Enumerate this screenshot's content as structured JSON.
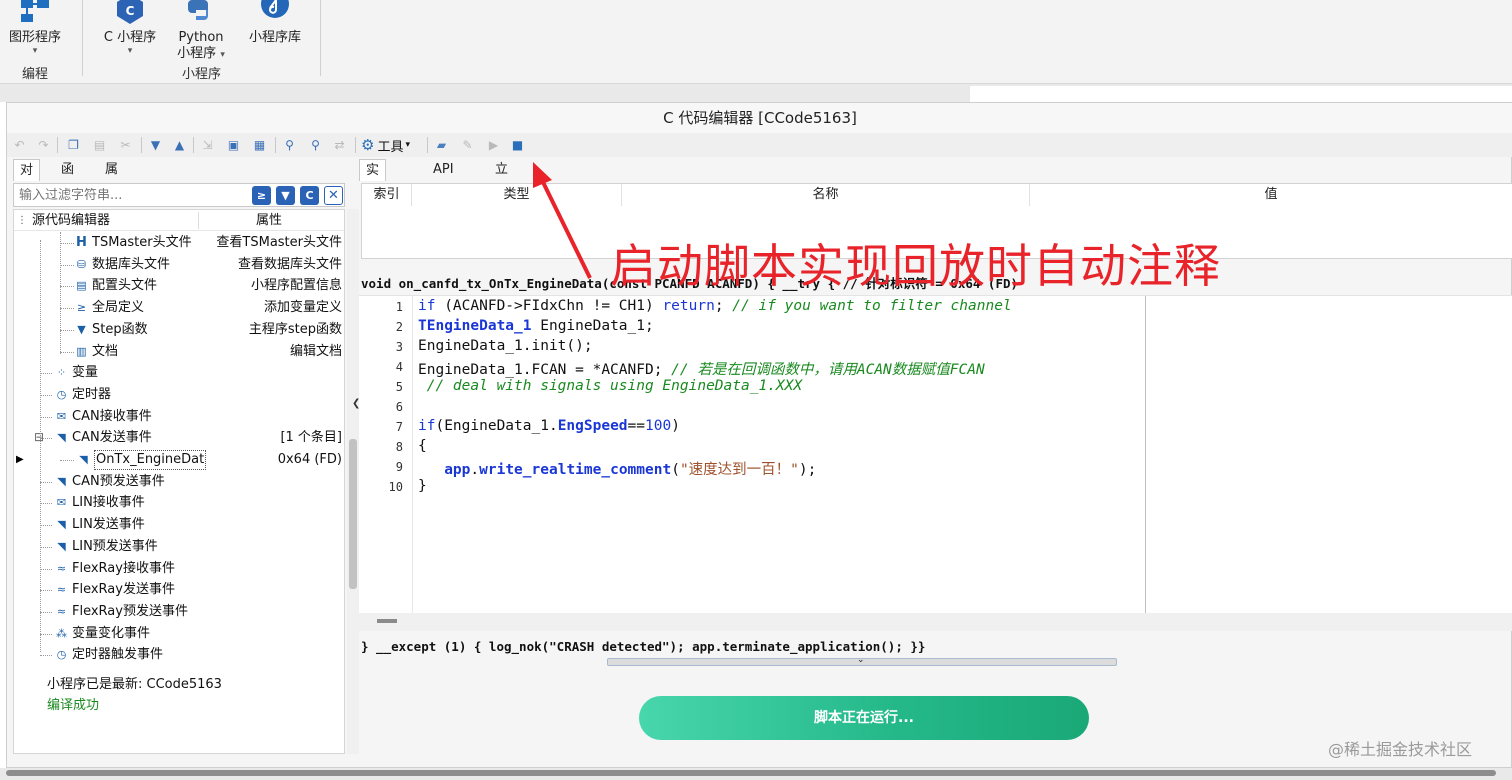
{
  "ribbon": {
    "graphic_program": "图形程序",
    "group_edit": "编程",
    "c_program": "C 小程序",
    "python_line1": "Python",
    "python_line2": "小程序",
    "library": "小程序库",
    "group_program": "小程序"
  },
  "window": {
    "title": "C 代码编辑器 [CCode5163]"
  },
  "toolbar": {
    "tools_label": "工具"
  },
  "left_tabs": [
    "对象",
    "函数",
    "属性"
  ],
  "filter": {
    "placeholder": "输入过滤字符串..."
  },
  "tree": {
    "header_name": "源代码编辑器",
    "header_prop": "属性",
    "rows": [
      {
        "name": "TSMaster头文件",
        "prop": "查看TSMaster头文件",
        "icon": "h-header-icon"
      },
      {
        "name": "数据库头文件",
        "prop": "查看数据库头文件",
        "icon": "database-icon"
      },
      {
        "name": "配置头文件",
        "prop": "小程序配置信息",
        "icon": "config-file-icon"
      },
      {
        "name": "全局定义",
        "prop": "添加变量定义",
        "icon": "global-define-icon"
      },
      {
        "name": "Step函数",
        "prop": "主程序step函数",
        "icon": "step-triangle-icon"
      },
      {
        "name": "文档",
        "prop": "编辑文档",
        "icon": "book-icon"
      },
      {
        "name": "变量",
        "prop": "",
        "icon": "variable-icon"
      },
      {
        "name": "定时器",
        "prop": "",
        "icon": "timer-icon"
      },
      {
        "name": "CAN接收事件",
        "prop": "",
        "icon": "mail-icon"
      },
      {
        "name": "CAN发送事件",
        "prop": "[1 个条目]",
        "icon": "send-icon"
      },
      {
        "name": "OnTx_EngineDat",
        "prop": "0x64 (FD)",
        "icon": "send-icon"
      },
      {
        "name": "CAN预发送事件",
        "prop": "",
        "icon": "send-icon"
      },
      {
        "name": "LIN接收事件",
        "prop": "",
        "icon": "mail-icon"
      },
      {
        "name": "LIN发送事件",
        "prop": "",
        "icon": "send-icon"
      },
      {
        "name": "LIN预发送事件",
        "prop": "",
        "icon": "send-icon"
      },
      {
        "name": "FlexRay接收事件",
        "prop": "",
        "icon": "flexray-icon"
      },
      {
        "name": "FlexRay发送事件",
        "prop": "",
        "icon": "flexray-icon"
      },
      {
        "name": "FlexRay预发送事件",
        "prop": "",
        "icon": "flexray-icon"
      },
      {
        "name": "变量变化事件",
        "prop": "",
        "icon": "var-change-icon"
      },
      {
        "name": "定时器触发事件",
        "prop": "",
        "icon": "timer-icon"
      }
    ]
  },
  "right_tabs": [
    "实时变量",
    "API文档",
    "立即文档"
  ],
  "var_table": {
    "columns": [
      "索引",
      "类型",
      "名称",
      "值"
    ]
  },
  "code": {
    "signature_top": "void on_canfd_tx_OnTx_EngineData(const PCANFD ACANFD) { __try { // 针对标识符 = 0x64 (FD)",
    "signature_bottom": "} __except (1) { log_nok(\"CRASH detected\"); app.terminate_application(); }}",
    "line_numbers": [
      "1",
      "2",
      "3",
      "4",
      "5",
      "6",
      "7",
      "8",
      "9",
      "10"
    ],
    "l1_kw": "if",
    "l1_mid": " (ACANFD->FIdxChn != CH1) ",
    "l1_ret": "return",
    "l1_end": ";",
    "l1_cm": " // if you want to filter channel",
    "l2_type": "TEngineData_1",
    "l2_rest": " EngineData_1;",
    "l3": "EngineData_1.init();",
    "l4_code": "EngineData_1.FCAN = *ACANFD;",
    "l4_cm": " // 若是在回调函数中，请用ACAN数据赋值FCAN",
    "l5_cm": " // deal with signals using EngineData_1.XXX",
    "l7_kw": "if",
    "l7_a": "(EngineData_1.",
    "l7_field": "EngSpeed",
    "l7_b": "==",
    "l7_num": "100",
    "l7_c": ")",
    "l8": "{",
    "l9_app": "app",
    "l9_dot": ".",
    "l9_fn": "write_realtime_comment",
    "l9_open": "(",
    "l9_str": "\"速度达到一百！\"",
    "l9_close": ");",
    "l10": "}"
  },
  "status": {
    "line1": "小程序已是最新: CCode5163",
    "line2": "编译成功"
  },
  "run_button": {
    "label": "脚本正在运行..."
  },
  "annotation": {
    "text": "启动脚本实现回放时自动注释",
    "color": "#e8232a"
  },
  "watermark": {
    "text": "@稀土掘金技术社区"
  },
  "colors": {
    "run_button": "#25b98a",
    "keyword": "#1a37d6",
    "comment": "#1a8a20",
    "success_text": "#1a8a20"
  }
}
